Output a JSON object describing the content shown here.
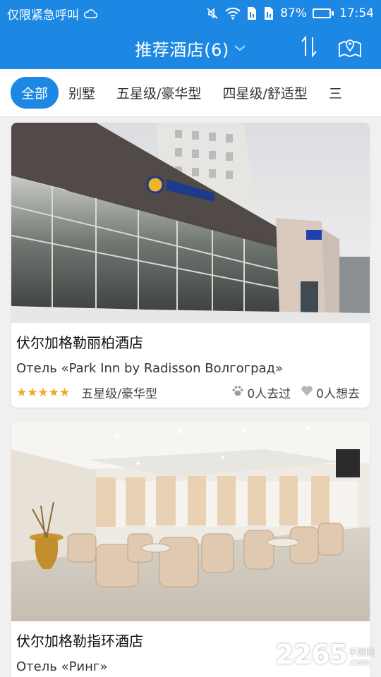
{
  "status_bar": {
    "carrier": "仅限紧急呼叫",
    "battery_percent": "87%",
    "battery_level": 0.87,
    "time": "17:54"
  },
  "header": {
    "title": "推荐酒店(6)",
    "sort_icon": "sort-arrows-icon",
    "map_icon": "map-pin-icon"
  },
  "tabs": [
    {
      "label": "全部",
      "active": true
    },
    {
      "label": "别墅",
      "active": false
    },
    {
      "label": "五星级/豪华型",
      "active": false
    },
    {
      "label": "四星级/舒适型",
      "active": false
    },
    {
      "label": "三",
      "active": false
    }
  ],
  "hotels": [
    {
      "name": "伏尔加格勒丽柏酒店",
      "subname": "Отель «Park Inn by Radisson Волгоград»",
      "stars": 5,
      "stars_text": "★★★★★",
      "level": "五星级/豪华型",
      "visited": "0人去过",
      "wanted": "0人想去"
    },
    {
      "name": "伏尔加格勒指环酒店",
      "subname": "Отель «Ринг»"
    }
  ],
  "colors": {
    "primary": "#1d88e3",
    "star": "#f5a623"
  },
  "watermark": {
    "number": "2265",
    "suffix": "手游网",
    "domain": ".com"
  }
}
